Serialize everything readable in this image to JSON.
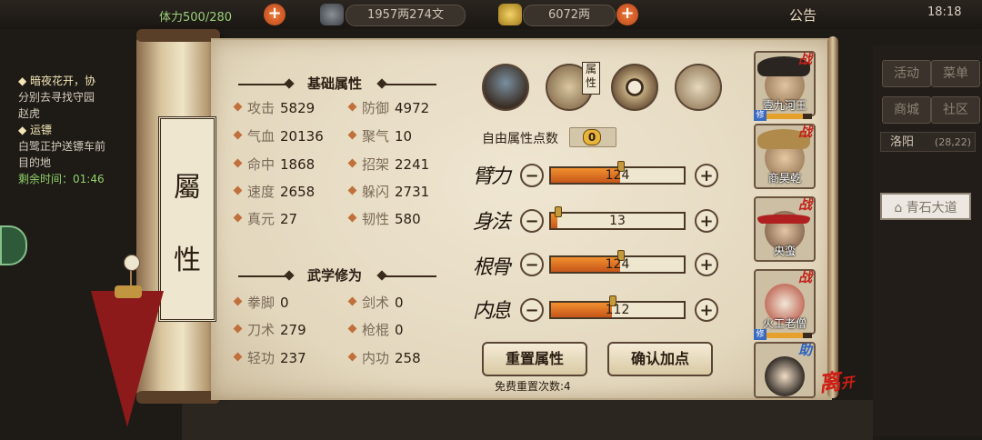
{
  "topbar": {
    "stamina": "体力500/280",
    "money": "1957两274文",
    "gold": "6072两",
    "notice": "公告",
    "time": "18:18"
  },
  "quests": {
    "q1_title": "暗夜花开，协",
    "q1_desc": "分别去寻找守园",
    "q1_desc2": "赵虎",
    "q2_title": "运镖",
    "q2_desc": "白鹭正护送镖车前",
    "q2_desc2": "目的地",
    "q2_time": "剩余时间：01:46"
  },
  "right_menu": {
    "b1": "活动",
    "b2": "菜单",
    "b3": "商城",
    "b4": "社区",
    "city": "洛阳",
    "coords": "(28,22)",
    "location": "青石大道"
  },
  "scroll_label": [
    "屬",
    "性"
  ],
  "basic": {
    "title": "基础属性",
    "stats": [
      {
        "name": "攻击",
        "value": "5829"
      },
      {
        "name": "防御",
        "value": "4972"
      },
      {
        "name": "气血",
        "value": "20136"
      },
      {
        "name": "聚气",
        "value": "10"
      },
      {
        "name": "命中",
        "value": "1868"
      },
      {
        "name": "招架",
        "value": "2241"
      },
      {
        "name": "速度",
        "value": "2658"
      },
      {
        "name": "躲闪",
        "value": "2731"
      },
      {
        "name": "真元",
        "value": "27"
      },
      {
        "name": "韧性",
        "value": "580"
      }
    ]
  },
  "martial": {
    "title": "武学修为",
    "stats": [
      {
        "name": "拳脚",
        "value": "0"
      },
      {
        "name": "剑术",
        "value": "0"
      },
      {
        "name": "刀术",
        "value": "279"
      },
      {
        "name": "枪棍",
        "value": "0"
      },
      {
        "name": "轻功",
        "value": "237"
      },
      {
        "name": "内功",
        "value": "258"
      }
    ]
  },
  "tabs": {
    "active_tag": "属性"
  },
  "free_points": {
    "label": "自由属性点数",
    "value": "0"
  },
  "attributes": [
    {
      "name": "臂力",
      "value": "124",
      "fill": 0.52
    },
    {
      "name": "身法",
      "value": "13",
      "fill": 0.05
    },
    {
      "name": "根骨",
      "value": "124",
      "fill": 0.52
    },
    {
      "name": "内息",
      "value": "112",
      "fill": 0.46
    }
  ],
  "buttons": {
    "reset": "重置属性",
    "confirm": "确认加点",
    "free_reset": "免费重置次数:4"
  },
  "team": [
    {
      "name": "壹九河王",
      "badge": "战"
    },
    {
      "name": "商昊乾",
      "badge": "战"
    },
    {
      "name": "央蛮",
      "badge": "战"
    },
    {
      "name": "火工老僧",
      "badge": "战"
    },
    {
      "name": "",
      "badge": "助"
    }
  ],
  "team_hp_tag": "修",
  "leave": {
    "big": "离",
    "small": "开"
  },
  "colors": {
    "accent": "#c5561a",
    "paper": "#e9dfca",
    "ink": "#2a1d12"
  }
}
